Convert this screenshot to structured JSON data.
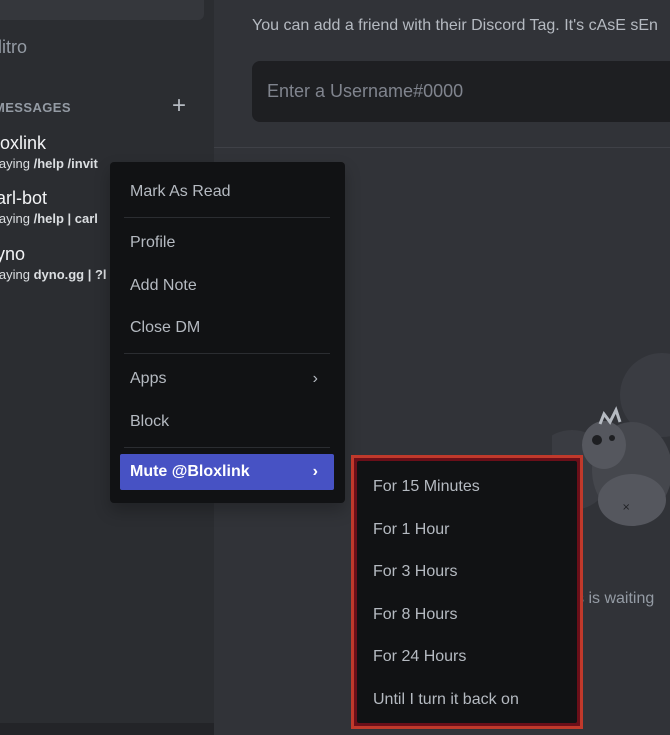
{
  "sidebar": {
    "nitro_label": "litro",
    "dm_header": "MESSAGES",
    "dm_add": "+",
    "dms": [
      {
        "name": "loxlink",
        "status_prefix": "laying ",
        "status_game": "/help /invit"
      },
      {
        "name": "arl-bot",
        "status_prefix": "laying ",
        "status_game": "/help | carl"
      },
      {
        "name": "yno",
        "status_prefix": "laying ",
        "status_game": "dyno.gg | ?l"
      }
    ]
  },
  "main": {
    "add_hint": "You can add a friend with their Discord Tag. It's cAsE sEn",
    "input_placeholder": "Enter a Username#0000",
    "waiting_text": "s is waiting"
  },
  "context_menu": {
    "items": [
      {
        "label": "Mark As Read"
      },
      {
        "label": "Profile"
      },
      {
        "label": "Add Note"
      },
      {
        "label": "Close DM"
      },
      {
        "label": "Apps",
        "chevron": "›"
      },
      {
        "label": "Block"
      },
      {
        "label": "Mute @Bloxlink",
        "chevron": "›"
      }
    ]
  },
  "mute_submenu": {
    "items": [
      {
        "label": "For 15 Minutes"
      },
      {
        "label": "For 1 Hour"
      },
      {
        "label": "For 3 Hours"
      },
      {
        "label": "For 8 Hours"
      },
      {
        "label": "For 24 Hours"
      },
      {
        "label": "Until I turn it back on"
      }
    ]
  },
  "colors": {
    "accent": "#4752c4",
    "highlight_border": "#c0392b",
    "menu_bg": "#111214"
  }
}
